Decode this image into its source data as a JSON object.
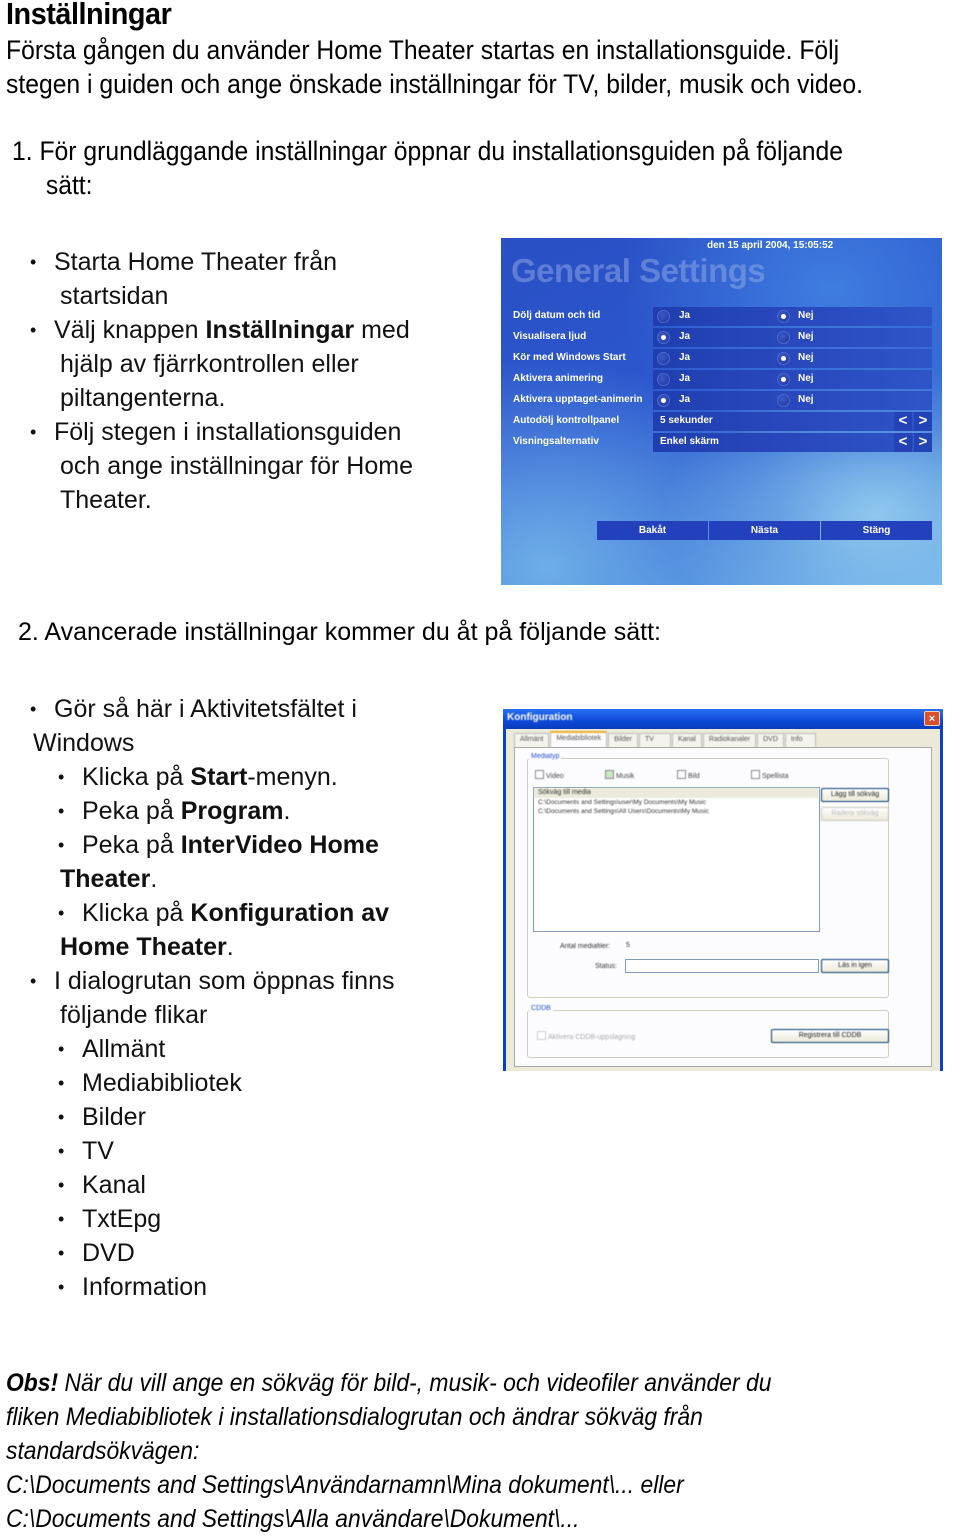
{
  "title": "Inställningar",
  "intro": [
    "Första gången du använder Home Theater startas en installationsguide. Följ",
    "stegen i guiden och ange önskade inställningar för TV, bilder, musik och video."
  ],
  "step1": {
    "line1": "1. För grundläggande inställningar öppnar du installationsguiden på följande",
    "line2": "sätt:",
    "bullets": {
      "b1_l1": "Starta Home Theater från",
      "b1_l2": "startsidan",
      "b2_pre": "Välj knappen ",
      "b2_bold": "Inställningar",
      "b2_post": " med",
      "b2_l2": "hjälp av fjärrkontrollen eller",
      "b2_l3": "piltangenterna.",
      "b3_l1": "Följ stegen i installationsguiden",
      "b3_l2": "och ange inställningar för Home",
      "b3_l3": "Theater."
    }
  },
  "general_settings": {
    "date": "den 15 april 2004, 15:05:52",
    "heading": "General Settings",
    "rows": [
      {
        "label": "Dölj datum och tid",
        "yes": "Ja",
        "no": "Nej",
        "selected": "no"
      },
      {
        "label": "Visualisera ljud",
        "yes": "Ja",
        "no": "Nej",
        "selected": "yes"
      },
      {
        "label": "Kör med Windows Start",
        "yes": "Ja",
        "no": "Nej",
        "selected": "no"
      },
      {
        "label": "Aktivera animering",
        "yes": "Ja",
        "no": "Nej",
        "selected": "no"
      },
      {
        "label": "Aktivera upptaget-animerin",
        "yes": "Ja",
        "no": "Nej",
        "selected": "yes"
      }
    ],
    "selects": [
      {
        "label": "Autodölj kontrollpanel",
        "value": "5 sekunder"
      },
      {
        "label": "Visningsalternativ",
        "value": "Enkel skärm"
      }
    ],
    "arrow_left": "<",
    "arrow_right": ">",
    "buttons": {
      "back": "Bakåt",
      "next": "Nästa",
      "close": "Stäng"
    }
  },
  "step2": {
    "heading": "2. Avancerade inställningar kommer du åt på följande sätt:",
    "b1_l1": "Gör så här i Aktivitetsfältet i",
    "b1_l2": "Windows",
    "s1_pre": "Klicka på ",
    "s1_bold": "Start",
    "s1_post": "-menyn.",
    "s2_pre": "Peka på ",
    "s2_bold": "Program",
    "s2_post": ".",
    "s3_pre": "Peka på ",
    "s3_bold": "InterVideo Home",
    "s3_bold2": "Theater",
    "s3_post": ".",
    "s4_pre": "Klicka på ",
    "s4_bold": "Konfiguration av",
    "s4_bold2": "Home Theater",
    "s4_post": ".",
    "b2_l1": "I dialogrutan som öppnas finns",
    "b2_l2": "följande flikar",
    "tabs": [
      "Allmänt",
      "Mediabibliotek",
      "Bilder",
      "TV",
      "Kanal",
      "TxtEpg",
      "DVD",
      "Information"
    ]
  },
  "config_dialog": {
    "title": "Konfiguration",
    "close": "×",
    "tabs": [
      "Allmänt",
      "Mediabibliotek",
      "Bilder",
      "TV",
      "Kanal",
      "Radiokanaler",
      "DVD",
      "Info"
    ],
    "media_group": "Mediatyp",
    "checkboxes": [
      {
        "label": "Video",
        "checked": false
      },
      {
        "label": "Musik",
        "checked": true
      },
      {
        "label": "Bild",
        "checked": false
      },
      {
        "label": "Spellista",
        "checked": false
      }
    ],
    "list_header": "Sökväg till media",
    "list_items": [
      "C:\\Documents and Settings\\user\\My Documents\\My Music",
      "C:\\Documents and Settings\\All Users\\Documents\\My Music"
    ],
    "add_path": "Lägg till sökväg",
    "remove_path": "Radera sökväg",
    "count_label": "Antal mediafiler:",
    "count_value": "5",
    "status_label": "Status:",
    "scan_button": "Läs in igen",
    "cddb_group": "CDDB",
    "cddb_check": "Aktivera CDDB-uppslagning",
    "register_button": "Registrera till CDDB"
  },
  "note": {
    "obs": "Obs!",
    "l1": " När du vill ange en sökväg för bild-, musik- och videofiler använder du",
    "l2": "fliken Mediabibliotek i installationsdialogrutan och ändrar sökväg från",
    "l3": "standardsökvägen:",
    "l4": "C:\\Documents and Settings\\Användarnamn\\Mina dokument\\... eller",
    "l5": "C:\\Documents and Settings\\Alla användare\\Dokument\\..."
  }
}
